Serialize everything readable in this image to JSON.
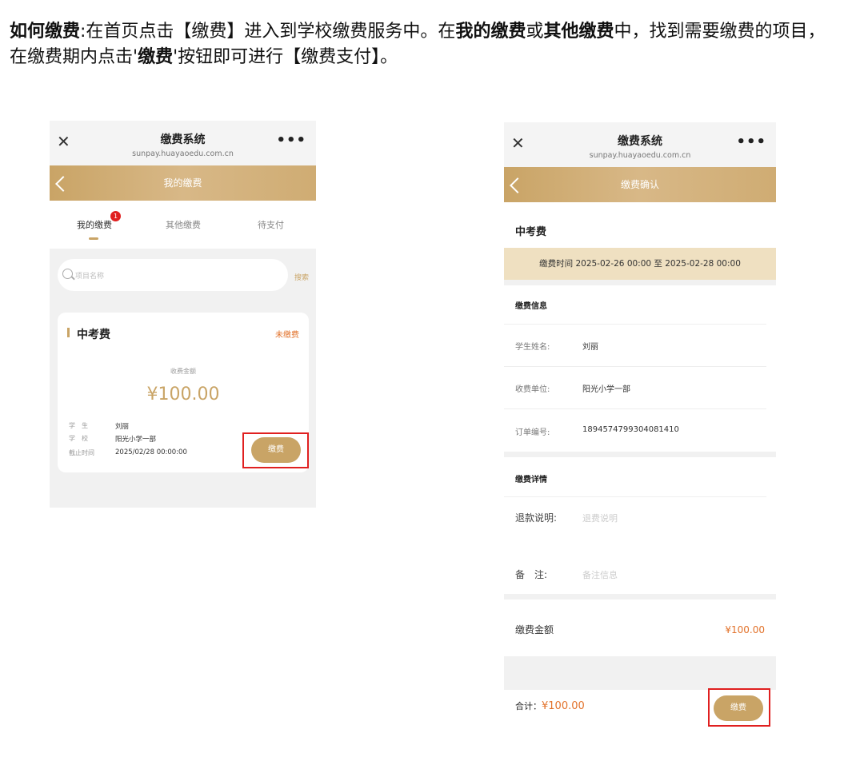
{
  "instruction": {
    "t1": "如何缴费",
    "t2": ":在首页点击【缴费】进入到学校缴费服务中。在",
    "t3": "我的缴费",
    "t4": "或",
    "t5": "其他缴费",
    "t6": "中，找到需要缴费的项目，",
    "t7": "在缴费期内点击'",
    "t8": "缴费",
    "t9": "'按钮即可进行【缴费支付】。"
  },
  "phone1": {
    "title": "缴费系统",
    "url": "sunpay.huayaoedu.com.cn",
    "nav_title": "我的缴费",
    "tabs": [
      "我的缴费",
      "其他缴费",
      "待支付"
    ],
    "badge": "1",
    "search_placeholder": "项目名称",
    "search_button": "搜索",
    "card": {
      "name": "中考费",
      "status": "未缴费",
      "amount_label": "收费金额",
      "amount": "¥100.00",
      "rows": [
        {
          "k": "学　生",
          "v": "刘丽"
        },
        {
          "k": "学　校",
          "v": "阳光小学一部"
        },
        {
          "k": "截止时间",
          "v": "2025/02/28 00:00:00"
        }
      ],
      "pay_button": "缴费"
    }
  },
  "phone2": {
    "title": "缴费系统",
    "url": "sunpay.huayaoedu.com.cn",
    "nav_title": "缴费确认",
    "item_title": "中考费",
    "period": "缴费时间 2025-02-26 00:00 至 2025-02-28 00:00",
    "info_title": "缴费信息",
    "info_rows": [
      {
        "k": "学生姓名:",
        "v": "刘丽"
      },
      {
        "k": "收费单位:",
        "v": "阳光小学一部"
      },
      {
        "k": "订单编号:",
        "v": "1894574799304081410"
      }
    ],
    "detail_title": "缴费详情",
    "refund_label": "退款说明:",
    "refund_placeholder": "退费说明",
    "remark_label": "备　注:",
    "remark_placeholder": "备注信息",
    "amount_label": "缴费金额",
    "amount_value": "¥100.00",
    "total_label": "合计：",
    "total_value": "¥100.00",
    "pay_button": "缴费"
  },
  "colors": {
    "accent": "#c9a466",
    "highlight": "#e02020",
    "price": "#e2722b"
  }
}
